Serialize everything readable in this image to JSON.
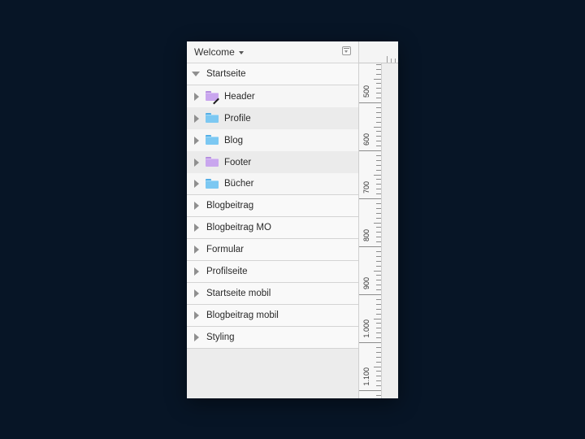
{
  "header": {
    "page_selector": "Welcome"
  },
  "tree": {
    "expanded_page": "Startseite",
    "children": [
      {
        "label": "Header",
        "folder_color": "#c9a6ee",
        "icon": "artboard-folder-icon"
      },
      {
        "label": "Profile",
        "folder_color": "#7cc8f2",
        "icon": "folder-icon"
      },
      {
        "label": "Blog",
        "folder_color": "#7cc8f2",
        "icon": "folder-icon"
      },
      {
        "label": "Footer",
        "folder_color": "#c9a6ee",
        "icon": "folder-icon"
      },
      {
        "label": "Bücher",
        "folder_color": "#7cc8f2",
        "icon": "folder-icon"
      }
    ],
    "pages": [
      "Blogbeitrag",
      "Blogbeitrag MO",
      "Formular",
      "Profilseite",
      "Startseite mobil",
      "Blogbeitrag mobil",
      "Styling"
    ]
  },
  "ruler": {
    "labels": [
      "500",
      "600",
      "700",
      "800",
      "900",
      "1.000",
      "1.100"
    ]
  }
}
